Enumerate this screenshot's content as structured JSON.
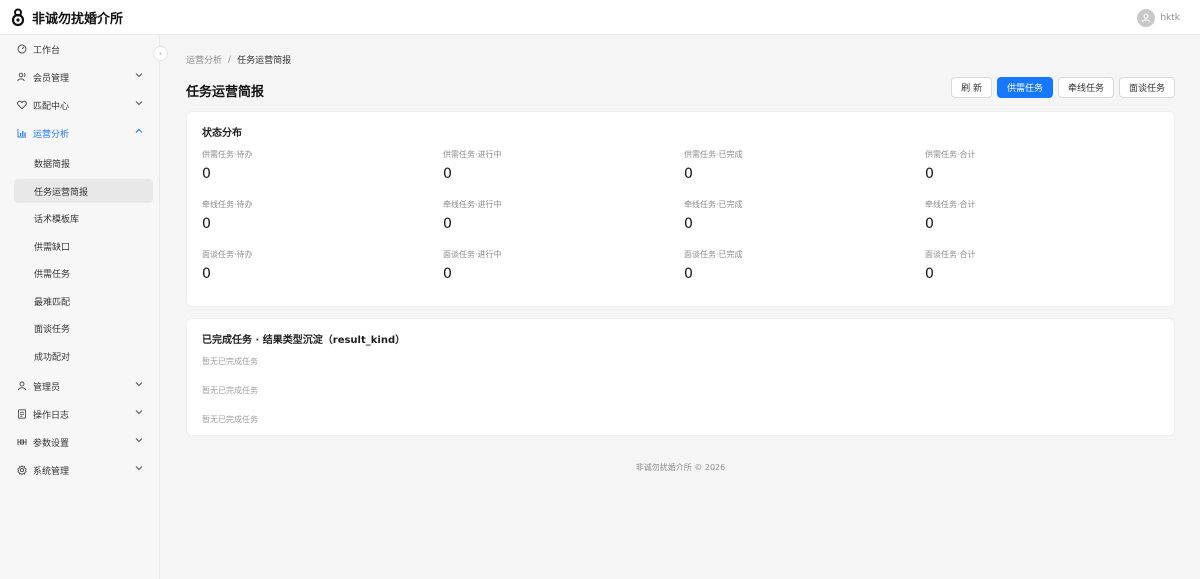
{
  "app": {
    "title": "非诚勿扰婚介所",
    "username": "hktk"
  },
  "sidebar": {
    "collapse_glyph": "‹",
    "items": [
      {
        "label": "工作台",
        "icon": "dashboard-icon"
      },
      {
        "label": "会员管理",
        "icon": "users-icon"
      },
      {
        "label": "匹配中心",
        "icon": "heart-icon"
      },
      {
        "label": "运营分析",
        "icon": "bar-chart-icon"
      }
    ],
    "sub_items": [
      {
        "label": "数据简报"
      },
      {
        "label": "任务运营简报"
      },
      {
        "label": "话术模板库"
      },
      {
        "label": "供需缺口"
      },
      {
        "label": "供需任务"
      },
      {
        "label": "最难匹配"
      },
      {
        "label": "面谈任务"
      },
      {
        "label": "成功配对"
      }
    ],
    "bottom_items": [
      {
        "label": "管理员",
        "icon": "user-icon"
      },
      {
        "label": "操作日志",
        "icon": "log-icon"
      },
      {
        "label": "参数设置",
        "icon": "sliders-icon"
      },
      {
        "label": "系统管理",
        "icon": "gear-icon"
      }
    ]
  },
  "breadcrumb": {
    "parent": "运营分析",
    "separator": "/",
    "current": "任务运营简报"
  },
  "page": {
    "title": "任务运营简报"
  },
  "actions": {
    "refresh": "刷 新",
    "supply": "供需任务",
    "matchmake": "牵线任务",
    "interview": "面谈任务"
  },
  "status_card": {
    "title": "状态分布",
    "rows": [
      [
        {
          "label": "供需任务·待办",
          "value": "0"
        },
        {
          "label": "供需任务·进行中",
          "value": "0"
        },
        {
          "label": "供需任务·已完成",
          "value": "0"
        },
        {
          "label": "供需任务·合计",
          "value": "0"
        }
      ],
      [
        {
          "label": "牵线任务·待办",
          "value": "0"
        },
        {
          "label": "牵线任务·进行中",
          "value": "0"
        },
        {
          "label": "牵线任务·已完成",
          "value": "0"
        },
        {
          "label": "牵线任务·合计",
          "value": "0"
        }
      ],
      [
        {
          "label": "面谈任务·待办",
          "value": "0"
        },
        {
          "label": "面谈任务·进行中",
          "value": "0"
        },
        {
          "label": "面谈任务·已完成",
          "value": "0"
        },
        {
          "label": "面谈任务·合计",
          "value": "0"
        }
      ]
    ]
  },
  "completed_card": {
    "title": "已完成任务 · 结果类型沉淀（result_kind）",
    "empty": [
      "暂无已完成任务",
      "暂无已完成任务",
      "暂无已完成任务"
    ]
  },
  "footer": {
    "text": "非诚勿扰婚介所 © 2026"
  },
  "colors": {
    "primary": "#1677ff",
    "background": "#f5f5f5"
  }
}
